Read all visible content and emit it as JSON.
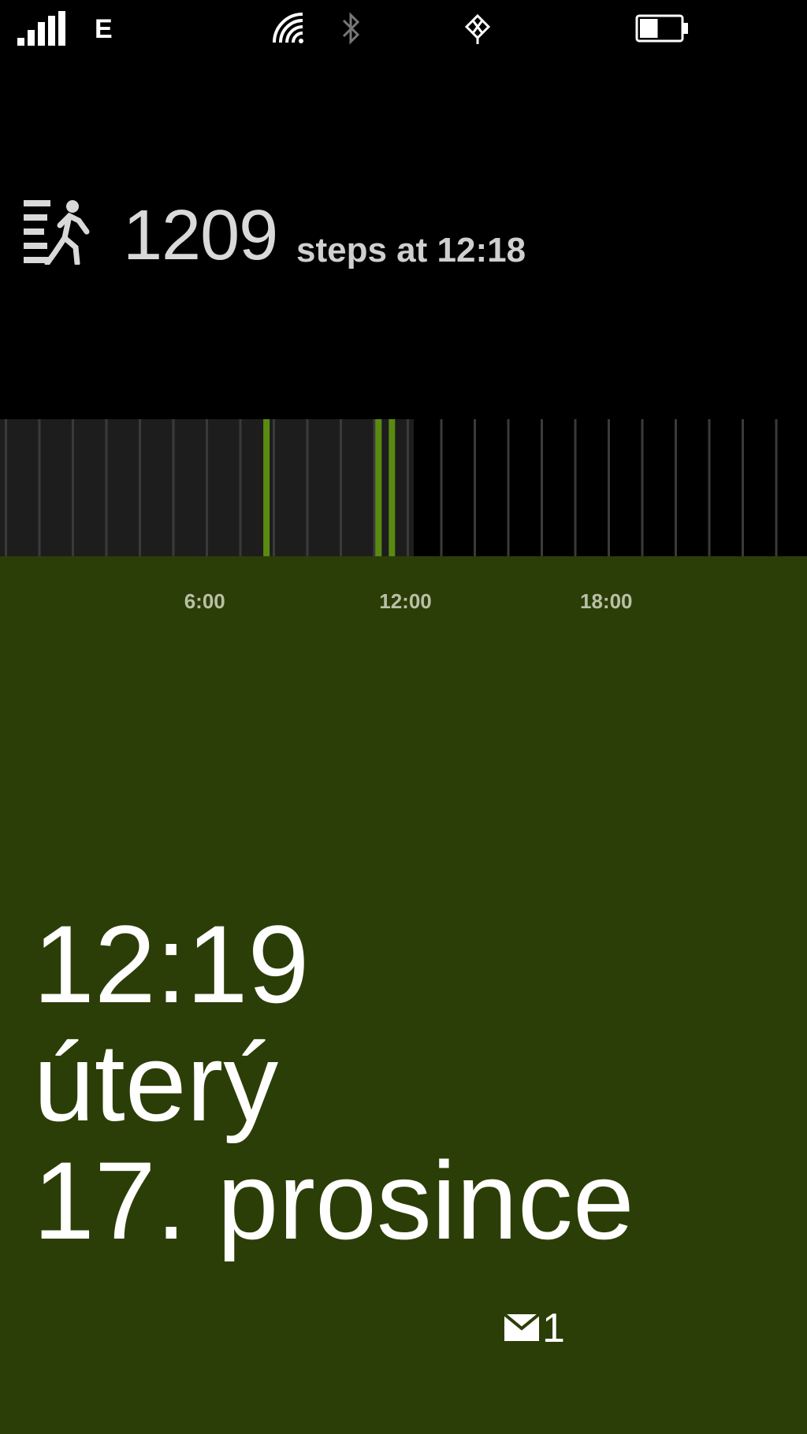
{
  "status_bar": {
    "network_type": "E",
    "icons": [
      "signal-strength-icon",
      "wifi-icon",
      "bluetooth-icon",
      "sync-icon",
      "battery-icon"
    ],
    "signal_level": 1.0,
    "battery_level": 0.45
  },
  "steps": {
    "icon": "walking-person-icon",
    "count": "1209",
    "caption": "steps at 12:18"
  },
  "timeline": {
    "hours_shown": 24,
    "elapsed_fraction": 0.5125,
    "activity_hours": [
      7.75,
      11.1,
      11.5
    ],
    "tick_labels": [
      "6:00",
      "12:00",
      "18:00"
    ],
    "tick_hours": [
      6,
      12,
      18
    ]
  },
  "lock": {
    "time": "12:19",
    "day": "úterý",
    "date": "17. prosince",
    "mail_icon": "mail-icon",
    "mail_count": "1"
  },
  "colors": {
    "panel_green": "#2c3e07",
    "activity_green": "#5a8a12",
    "timeline_past": "#1d1d1d"
  }
}
